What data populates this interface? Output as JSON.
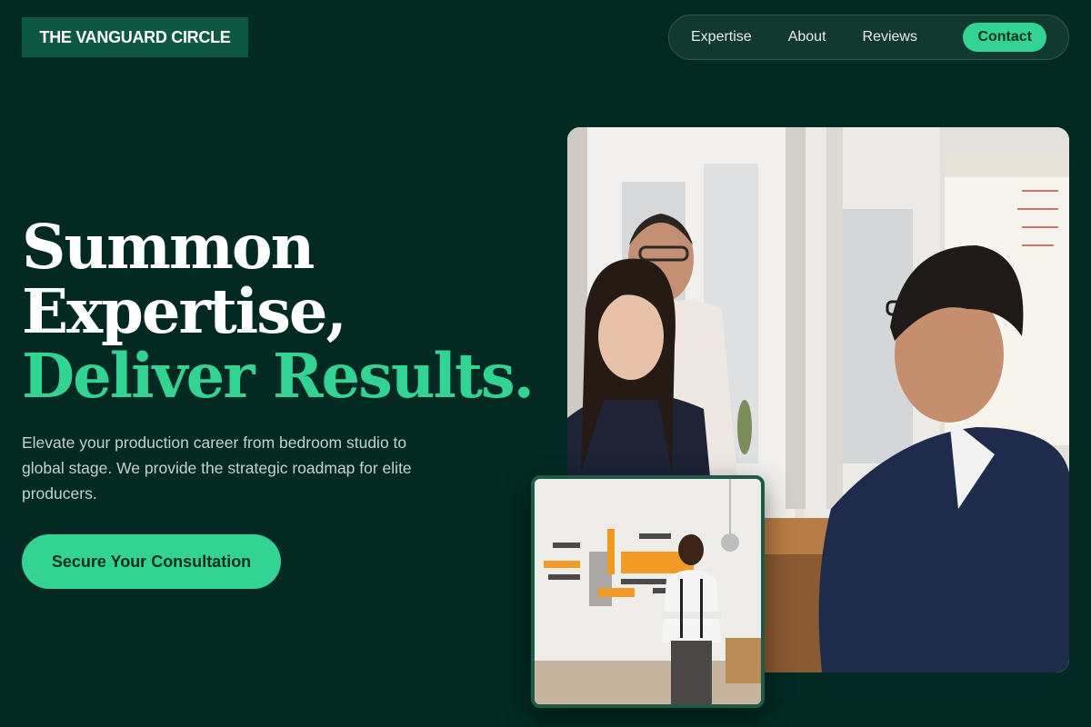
{
  "brand": {
    "name": "THE VANGUARD CIRCLE"
  },
  "nav": {
    "items": [
      "Expertise",
      "About",
      "Reviews"
    ],
    "contact_label": "Contact"
  },
  "hero": {
    "headline_line1": "Summon",
    "headline_line2": "Expertise,",
    "headline_line3": "Deliver Results.",
    "subtext": "Elevate your production career from bedroom studio to global stage. We provide the strategic roadmap for elite producers.",
    "cta_label": "Secure Your Consultation"
  },
  "images": {
    "main": "office-meeting-photo",
    "secondary": "make-it-word-wall-photo"
  },
  "colors": {
    "background": "#022a22",
    "accent": "#33d393",
    "brand_box": "#0c5840"
  }
}
